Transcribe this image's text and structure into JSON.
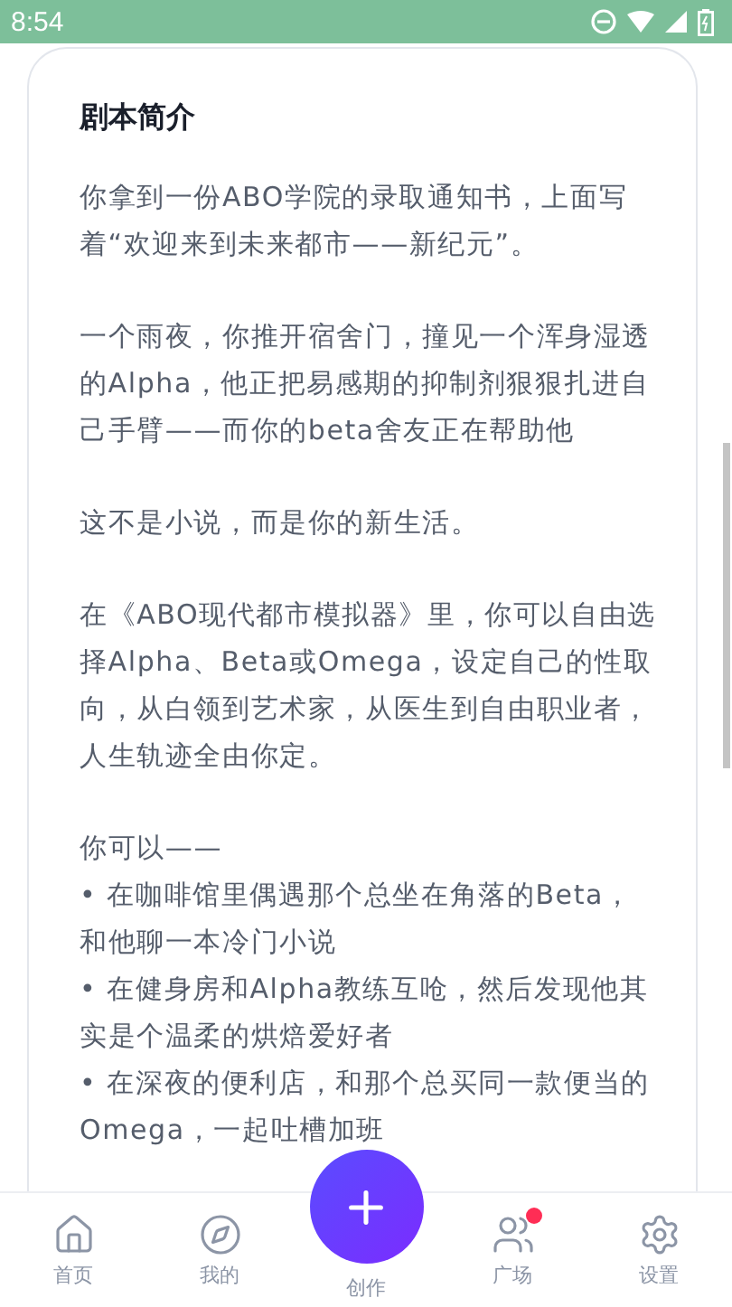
{
  "status_bar": {
    "time": "8:54"
  },
  "card": {
    "title": "剧本简介",
    "paragraphs": [
      {
        "kind": "text",
        "text": "你拿到一份ABO学院的录取通知书，上面写着“欢迎来到未来都市——新纪元”。"
      },
      {
        "kind": "text",
        "text": "一个雨夜，你推开宿舍门，撞见一个浑身湿透的Alpha，他正把易感期的抑制剂狠狠扎进自己手臂——而你的beta舍友正在帮助他"
      },
      {
        "kind": "text",
        "text": "这不是小说，而是你的新生活。"
      },
      {
        "kind": "text",
        "text": "在《ABO现代都市模拟器》里，你可以自由选择Alpha、Beta或Omega，设定自己的性取向，从白领到艺术家，从医生到自由职业者，人生轨迹全由你定。"
      },
      {
        "kind": "list",
        "text": "你可以——",
        "items": [
          "• 在咖啡馆里偶遇那个总坐在角落的Beta，和他聊一本冷门小说",
          "• 在健身房和Alpha教练互呛，然后发现他其实是个温柔的烘焙爱好者",
          "• 在深夜的便利店，和那个总买同一款便当的Omega，一起吐槽加班"
        ]
      }
    ]
  },
  "nav": {
    "items": [
      {
        "kind": "home",
        "label": "首页",
        "badge": false
      },
      {
        "kind": "compass",
        "label": "我的",
        "badge": false
      },
      {
        "kind": "create",
        "label": "创作"
      },
      {
        "kind": "users",
        "label": "广场",
        "badge": true
      },
      {
        "kind": "settings",
        "label": "设置",
        "badge": false
      }
    ]
  }
}
